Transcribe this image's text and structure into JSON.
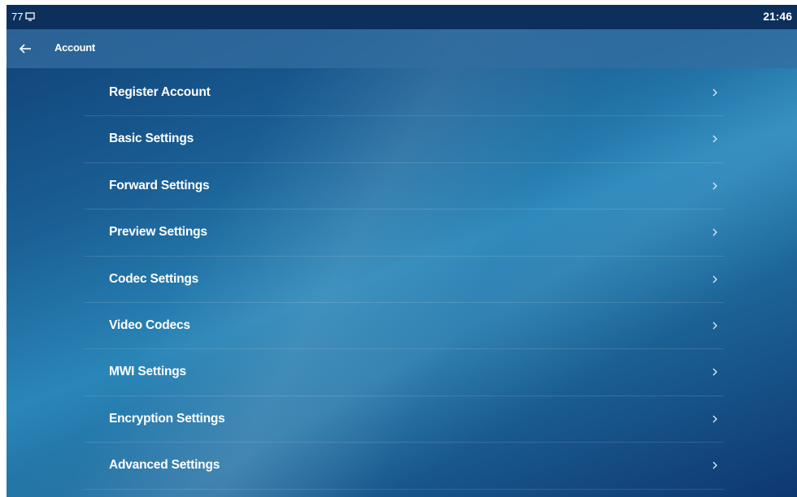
{
  "status_bar": {
    "left_text": "77",
    "left_icon": "monitor-icon",
    "time": "21:46"
  },
  "header": {
    "back_icon": "arrow-left-icon",
    "title": "Account"
  },
  "menu": {
    "chevron_icon": "chevron-right-icon",
    "items": [
      {
        "label": "Register Account"
      },
      {
        "label": "Basic Settings"
      },
      {
        "label": "Forward Settings"
      },
      {
        "label": "Preview Settings"
      },
      {
        "label": "Codec Settings"
      },
      {
        "label": "Video Codecs"
      },
      {
        "label": "MWI Settings"
      },
      {
        "label": "Encryption Settings"
      },
      {
        "label": "Advanced Settings"
      }
    ]
  },
  "colors": {
    "status_bar": "#0c2f5c",
    "background_dark": "#0f3e73",
    "background_light": "#2a86b8",
    "text": "#ffffff"
  }
}
